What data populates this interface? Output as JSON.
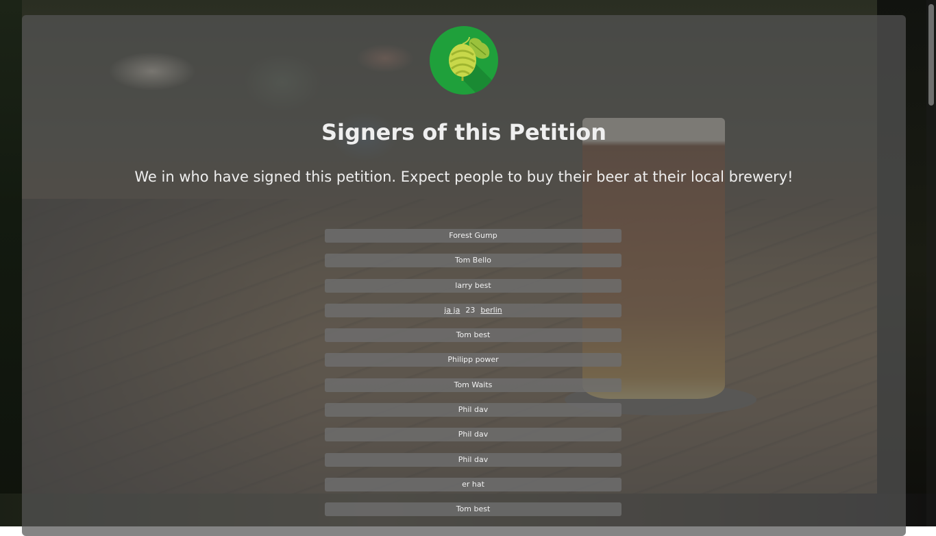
{
  "page": {
    "title": "Signers of this Petition",
    "subtitle": "We in who have signed this petition. Expect people to buy their beer at their local brewery!"
  },
  "logo": {
    "icon": "hop-icon",
    "background_color": "#1fa03b"
  },
  "signers": [
    {
      "name": "Forest Gump"
    },
    {
      "name": "Tom Bello"
    },
    {
      "name": "larry best"
    },
    {
      "name": "ja ja",
      "age": "23",
      "city": "berlin"
    },
    {
      "name": "Tom best"
    },
    {
      "name": "Philipp power"
    },
    {
      "name": "Tom Waits"
    },
    {
      "name": "Phil dav"
    },
    {
      "name": "Phil dav"
    },
    {
      "name": "Phil dav"
    },
    {
      "name": "er hat"
    },
    {
      "name": "Tom best"
    }
  ]
}
